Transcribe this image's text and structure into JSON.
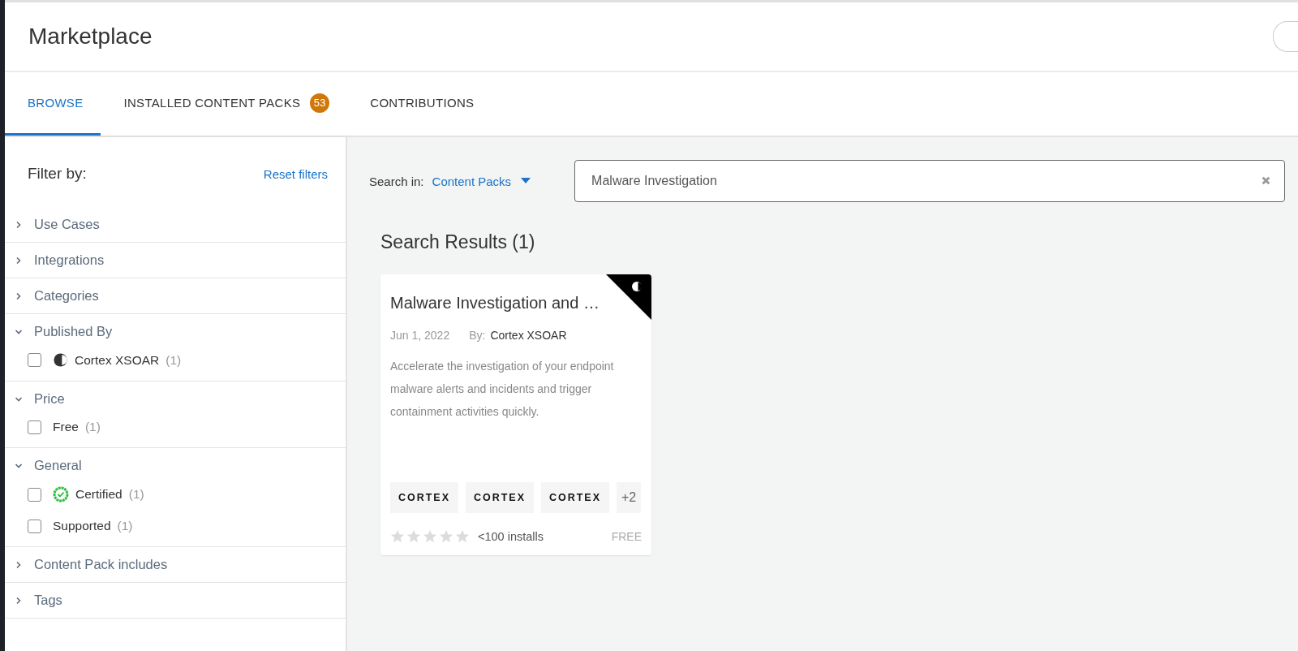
{
  "header": {
    "title": "Marketplace"
  },
  "tabs": [
    {
      "label": "BROWSE",
      "selected": true
    },
    {
      "label": "INSTALLED CONTENT PACKS",
      "selected": false,
      "badge": "53"
    },
    {
      "label": "CONTRIBUTIONS",
      "selected": false
    }
  ],
  "sidebar": {
    "title": "Filter by:",
    "reset": "Reset filters",
    "sections": [
      {
        "label": "Use Cases",
        "expanded": false
      },
      {
        "label": "Integrations",
        "expanded": false
      },
      {
        "label": "Categories",
        "expanded": false
      },
      {
        "label": "Published By",
        "expanded": true,
        "options": [
          {
            "label": "Cortex XSOAR",
            "count": "(1)",
            "checked": false,
            "kind": "publisher"
          }
        ]
      },
      {
        "label": "Price",
        "expanded": true,
        "options": [
          {
            "label": "Free",
            "count": "(1)",
            "checked": false
          }
        ]
      },
      {
        "label": "General",
        "expanded": true,
        "options": [
          {
            "label": "Certified",
            "count": "(1)",
            "checked": false,
            "kind": "certified"
          },
          {
            "label": "Supported",
            "count": "(1)",
            "checked": false
          }
        ]
      },
      {
        "label": "Content Pack includes",
        "expanded": false
      },
      {
        "label": "Tags",
        "expanded": false
      }
    ]
  },
  "search": {
    "label": "Search in:",
    "scope": "Content Packs",
    "value": "Malware Investigation"
  },
  "results": {
    "title": "Search Results (1)",
    "cards": [
      {
        "title": "Malware Investigation and …",
        "date": "Jun 1, 2022",
        "by_label": "By:",
        "author": "Cortex XSOAR",
        "description": "Accelerate the investigation of your endpoint malware alerts and incidents and trigger containment activities quickly.",
        "logos": [
          "CORTEX",
          "CORTEX",
          "CORTEX"
        ],
        "more": "+2",
        "stars": 0,
        "installs": "<100 installs",
        "price": "FREE"
      }
    ]
  }
}
